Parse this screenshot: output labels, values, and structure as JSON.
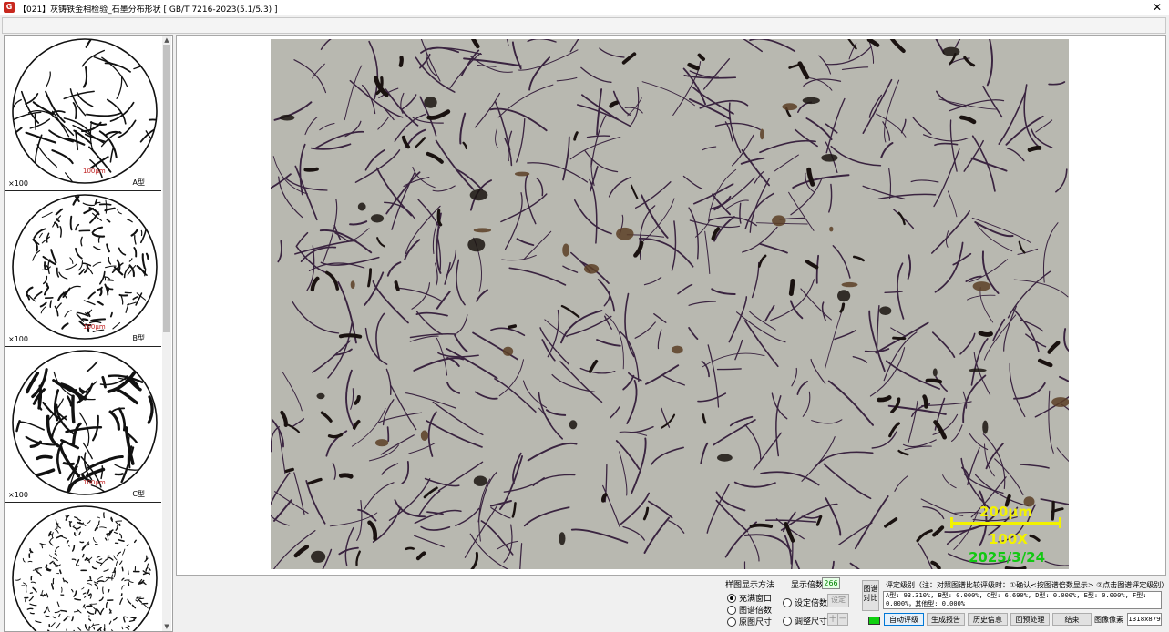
{
  "window": {
    "title": "【021】灰铸铁金相检验_石墨分布形状 [ GB/T 7216-2023(5.1/5.3) ]",
    "app_icon": "app-logo-icon",
    "close_glyph": "✕"
  },
  "thumbnails": [
    {
      "type_label": "A型",
      "magnification": "×100",
      "scale_text": "100μm"
    },
    {
      "type_label": "B型",
      "magnification": "×100",
      "scale_text": "100μm"
    },
    {
      "type_label": "C型",
      "magnification": "×100",
      "scale_text": "100μm"
    },
    {
      "type_label": "",
      "magnification": "",
      "scale_text": ""
    }
  ],
  "image_overlay": {
    "scale_text": "200μm",
    "magnification_text": "100X",
    "date_text": "2025/3/24",
    "scale_color": "#f2f200",
    "date_color": "#12c812"
  },
  "display_method": {
    "title": "样图显示方法",
    "options": [
      {
        "label": "充满窗口",
        "selected": true
      },
      {
        "label": "图谱倍数",
        "selected": false
      },
      {
        "label": "原图尺寸",
        "selected": false
      }
    ]
  },
  "display_magnification": {
    "title": "显示倍数",
    "value": "266",
    "set_label": "设定倍数",
    "set_button": "设定",
    "adjust_label": "调整尺寸",
    "plus_button": "十",
    "minus_button": "一"
  },
  "grading": {
    "vertical_button": "图谱对比",
    "label": "评定级别（注：对照图谱比较评级时：①确认<按图谱倍数显示> ②点击图谱评定级别）",
    "result_line1": "A型: 93.310%, B型: 0.000%, C型: 6.690%, D型: 0.000%, E型: 0.000%, F型:",
    "result_line2": "0.000%，其他型: 0.000%"
  },
  "actions": [
    {
      "label": "自动评级",
      "primary": true
    },
    {
      "label": "生成报告",
      "primary": false
    },
    {
      "label": "历史信息",
      "primary": false
    },
    {
      "label": "回预处理",
      "primary": false
    },
    {
      "label": "结束",
      "primary": false
    }
  ],
  "pixel_info": {
    "label": "图像像素",
    "value": "1318x879"
  },
  "colors": {
    "status_led": "#10d010",
    "accent": "#0078d7"
  }
}
